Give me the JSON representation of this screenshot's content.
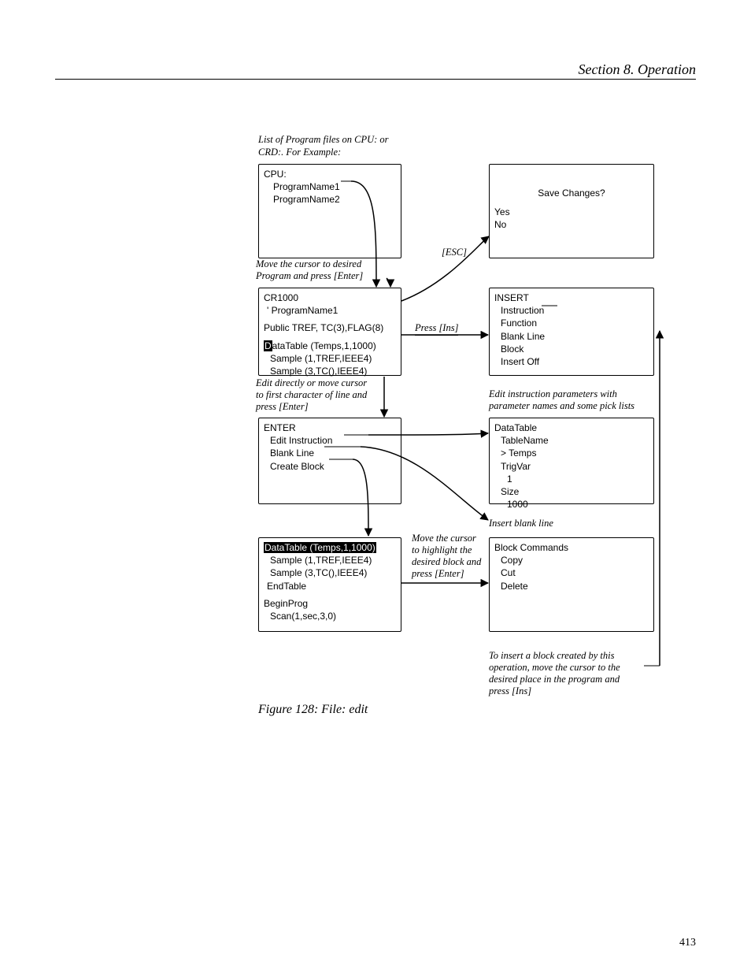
{
  "header": "Section 8.  Operation",
  "figure_caption": "Figure 128: File: edit",
  "page_number": "413",
  "caption_top_l1": "List of Program files on CPU: or",
  "caption_top_l2": "CRD:. For Example:",
  "boxA": {
    "l1": "CPU:",
    "l2": "ProgramName1",
    "l3": "ProgramName2"
  },
  "noteA_l1": "Move the cursor to desired",
  "noteA_l2": "Program and press [Enter]",
  "boxB": {
    "l1": "CR1000",
    "l2": "'  ProgramName1",
    "l3": "Public TREF, TC(3),FLAG(8)",
    "l4a": "D",
    "l4b": "ataTable (Temps,1,1000)",
    "l5": "Sample (1,TREF,IEEE4)",
    "l6": "Sample (3,TC(),IEEE4)"
  },
  "noteB_l1": "Edit directly or move cursor",
  "noteB_l2": "to first character of line and",
  "noteB_l3": "press [Enter]",
  "boxC": {
    "l1": "ENTER",
    "l2": "Edit Instruction",
    "l3": "Blank Line",
    "l4": "Create Block"
  },
  "boxD": {
    "l1a": "DataTable (Temps,1,1000)",
    "l2": "Sample (1,TREF,IEEE4)",
    "l3": "Sample (3,TC(),IEEE4)",
    "l4": "EndTable",
    "l5": "BeginProg",
    "l6": "Scan(1,sec,3,0)"
  },
  "boxE": {
    "l1": "Save Changes?",
    "l2": "Yes",
    "l3": "No"
  },
  "boxF": {
    "l1": "INSERT",
    "l2": "Instruction",
    "l3": "Function",
    "l4": "Blank Line",
    "l5": "Block",
    "l6": "Insert Off"
  },
  "noteF_l1": "Edit instruction parameters with",
  "noteF_l2": "parameter names and some pick lists",
  "boxG": {
    "l1": "DataTable",
    "l2": "TableName",
    "l3": "> Temps",
    "l4": "TrigVar",
    "l5": "1",
    "l6": "Size",
    "l7": "1000"
  },
  "noteG": "Insert blank line",
  "boxH": {
    "l1": "Block Commands",
    "l2": "Copy",
    "l3": "Cut",
    "l4": "Delete"
  },
  "noteH_l1": "To insert a block created by this",
  "noteH_l2": "operation, move the cursor to the",
  "noteH_l3": "desired place in the program and",
  "noteH_l4": "press [Ins]",
  "label_esc": "[ESC]",
  "label_ins": "Press [Ins]",
  "label_block_l1": "Move the cursor",
  "label_block_l2": "to highlight the",
  "label_block_l3": "desired block and",
  "label_block_l4": "press [Enter]"
}
